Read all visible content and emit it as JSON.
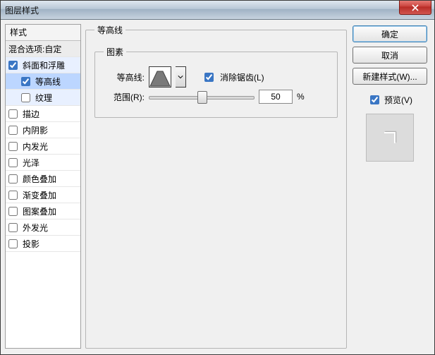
{
  "window": {
    "title": "图层样式"
  },
  "sidebar": {
    "header": "样式",
    "blend_label": "混合选项:自定",
    "items": [
      {
        "label": "斜面和浮雕",
        "checked": true,
        "indent": 0,
        "state": "highlight"
      },
      {
        "label": "等高线",
        "checked": true,
        "indent": 1,
        "state": "selected"
      },
      {
        "label": "纹理",
        "checked": false,
        "indent": 1,
        "state": "highlight"
      },
      {
        "label": "描边",
        "checked": false,
        "indent": 0,
        "state": ""
      },
      {
        "label": "内阴影",
        "checked": false,
        "indent": 0,
        "state": ""
      },
      {
        "label": "内发光",
        "checked": false,
        "indent": 0,
        "state": ""
      },
      {
        "label": "光泽",
        "checked": false,
        "indent": 0,
        "state": ""
      },
      {
        "label": "颜色叠加",
        "checked": false,
        "indent": 0,
        "state": ""
      },
      {
        "label": "渐变叠加",
        "checked": false,
        "indent": 0,
        "state": ""
      },
      {
        "label": "图案叠加",
        "checked": false,
        "indent": 0,
        "state": ""
      },
      {
        "label": "外发光",
        "checked": false,
        "indent": 0,
        "state": ""
      },
      {
        "label": "投影",
        "checked": false,
        "indent": 0,
        "state": ""
      }
    ]
  },
  "panel": {
    "group_title": "等高线",
    "subgroup_title": "图素",
    "contour_label": "等高线:",
    "antialias_label": "消除锯齿(L)",
    "antialias_checked": true,
    "range_label": "范围(R):",
    "range_value": "50",
    "range_unit": "%"
  },
  "buttons": {
    "ok": "确定",
    "cancel": "取消",
    "new_style": "新建样式(W)...",
    "preview_label": "预览(V)",
    "preview_checked": true
  }
}
